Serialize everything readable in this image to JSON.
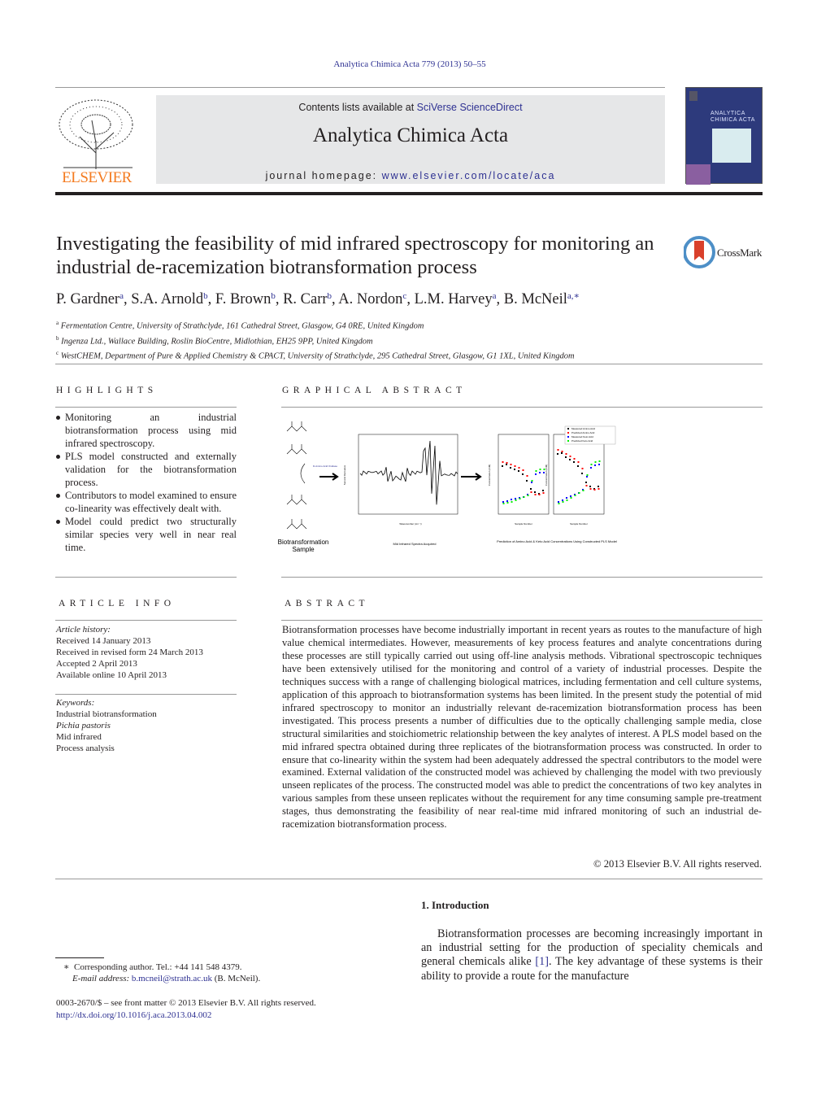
{
  "journal_ref": "Analytica Chimica Acta 779 (2013) 50–55",
  "header": {
    "publisher_logo": "ELSEVIER",
    "contents_prefix": "Contents lists available at ",
    "contents_link": "SciVerse ScienceDirect",
    "journal_title": "Analytica Chimica Acta",
    "homepage_prefix": "journal homepage: ",
    "homepage_link": "www.elsevier.com/locate/aca",
    "cover_title": "ANALYTICA CHIMICA ACTA"
  },
  "crossmark": "CrossMark",
  "article": {
    "title": "Investigating the feasibility of mid infrared spectroscopy for monitoring an industrial de-racemization biotransformation process",
    "authors": [
      {
        "name": "P. Gardner",
        "sup": "a"
      },
      {
        "name": "S.A. Arnold",
        "sup": "b"
      },
      {
        "name": "F. Brown",
        "sup": "b"
      },
      {
        "name": "R. Carr",
        "sup": "b"
      },
      {
        "name": "A. Nordon",
        "sup": "c"
      },
      {
        "name": "L.M. Harvey",
        "sup": "a"
      },
      {
        "name": "B. McNeil",
        "sup": "a,∗"
      }
    ],
    "affiliations": [
      {
        "sup": "a",
        "text": "Fermentation Centre, University of Strathclyde, 161 Cathedral Street, Glasgow, G4 0RE, United Kingdom"
      },
      {
        "sup": "b",
        "text": "Ingenza Ltd., Wallace Building, Roslin BioCentre, Midlothian, EH25 9PP, United Kingdom"
      },
      {
        "sup": "c",
        "text": "WestCHEM, Department of Pure & Applied Chemistry & CPACT, University of Strathclyde, 295 Cathedral Street, Glasgow, G1 1XL, United Kingdom"
      }
    ]
  },
  "highlights": {
    "heading": "HIGHLIGHTS",
    "items": [
      "Monitoring an industrial biotransformation process using mid infrared spectroscopy.",
      "PLS model constructed and externally validation for the biotransformation process.",
      "Contributors to model examined to ensure co-linearity was effectively dealt with.",
      "Model could predict two structurally similar species very well in near real time."
    ]
  },
  "graphical_abstract": {
    "heading": "GRAPHICAL ABSTRACT",
    "caption_left": "Biotransformation Sample",
    "caption_middle": "Mid Infrared Spectra Acquired",
    "caption_right": "Prediction of Amino Acid & Keto Acid Concentrations Using Constructed PLS Model",
    "oxidase_label": "D-Amino Acid Oxidase",
    "legend": [
      "Measured Amino Acid",
      "Predicted Amino Acid",
      "Measured Keto Acid",
      "Predicted Keto Acid"
    ],
    "colors": {
      "measured_amino": "#000000",
      "predicted_amino": "#ff0000",
      "measured_keto": "#0000ff",
      "predicted_keto": "#00ee00"
    },
    "spectrum_xlabel": "Wavenumber (cm⁻¹)",
    "spectrum_ylabel": "Second Derivative",
    "scatter_xlabel": "Sample Number",
    "scatter_ylabel": "Concentration (mM)"
  },
  "article_info": {
    "heading": "ARTICLE INFO",
    "history_label": "Article history:",
    "history": [
      "Received 14 January 2013",
      "Received in revised form 24 March 2013",
      "Accepted 2 April 2013",
      "Available online 10 April 2013"
    ],
    "keywords_label": "Keywords:",
    "keywords": [
      "Industrial biotransformation",
      "Pichia pastoris",
      "Mid infrared",
      "Process analysis"
    ]
  },
  "abstract": {
    "heading": "ABSTRACT",
    "text": "Biotransformation processes have become industrially important in recent years as routes to the manufacture of high value chemical intermediates. However, measurements of key process features and analyte concentrations during these processes are still typically carried out using off-line analysis methods. Vibrational spectroscopic techniques have been extensively utilised for the monitoring and control of a variety of industrial processes. Despite the techniques success with a range of challenging biological matrices, including fermentation and cell culture systems, application of this approach to biotransformation systems has been limited. In the present study the potential of mid infrared spectroscopy to monitor an industrially relevant de-racemization biotransformation process has been investigated. This process presents a number of difficulties due to the optically challenging sample media, close structural similarities and stoichiometric relationship between the key analytes of interest. A PLS model based on the mid infrared spectra obtained during three replicates of the biotransformation process was constructed. In order to ensure that co-linearity within the system had been adequately addressed the spectral contributors to the model were examined. External validation of the constructed model was achieved by challenging the model with two previously unseen replicates of the process. The constructed model was able to predict the concentrations of two key analytes in various samples from these unseen replicates without the requirement for any time consuming sample pre-treatment stages, thus demonstrating the feasibility of near real-time mid infrared monitoring of such an industrial de-racemization biotransformation process.",
    "copyright": "© 2013 Elsevier B.V. All rights reserved."
  },
  "introduction": {
    "heading": "1.  Introduction",
    "text_before_ref": "Biotransformation processes are becoming increasingly important in an industrial setting for the production of speciality chemicals and general chemicals alike ",
    "ref": "[1]",
    "text_after_ref": ". The key advantage of these systems is their ability to provide a route for the manufacture"
  },
  "footnote": {
    "marker": "∗",
    "line1": "Corresponding author. Tel.: +44 141 548 4379.",
    "email_label": "E-mail address:",
    "email": "b.mcneil@strath.ac.uk",
    "email_suffix": " (B. McNeil)."
  },
  "front_matter": "0003-2670/$ – see front matter © 2013 Elsevier B.V. All rights reserved.",
  "doi": "http://dx.doi.org/10.1016/j.aca.2013.04.002"
}
